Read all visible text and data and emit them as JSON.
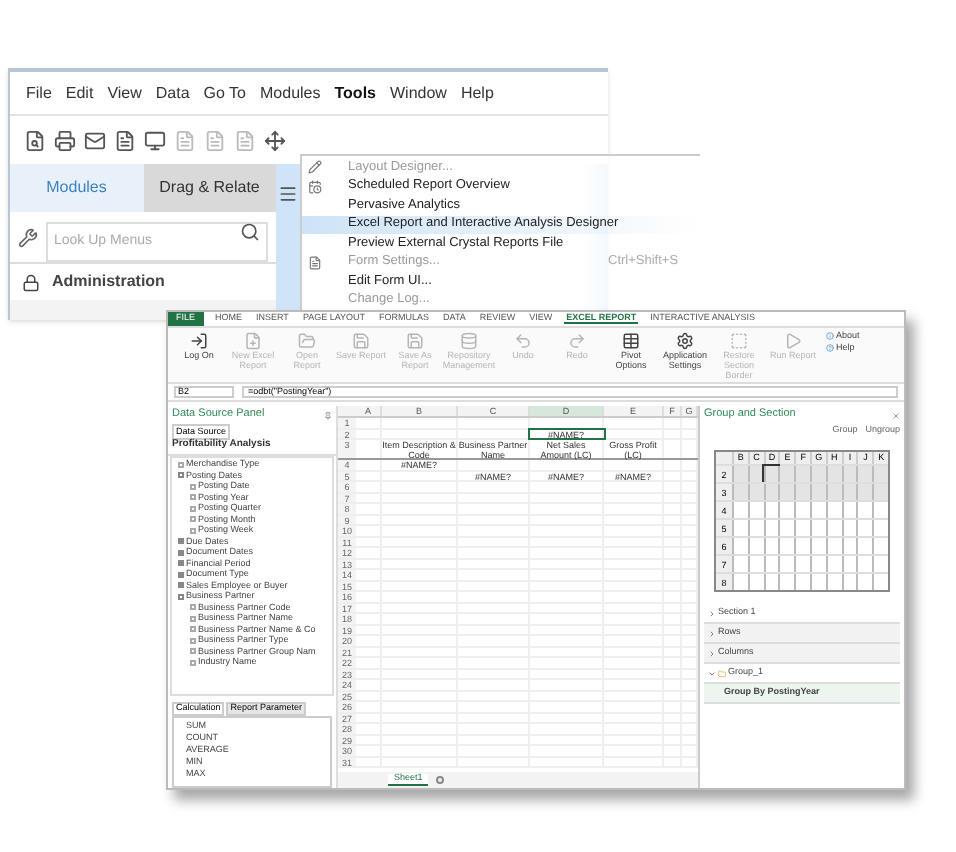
{
  "main_window": {
    "menu": [
      {
        "label": "File",
        "selected": false
      },
      {
        "label": "Edit",
        "selected": false
      },
      {
        "label": "View",
        "selected": false
      },
      {
        "label": "Data",
        "selected": false
      },
      {
        "label": "Go To",
        "selected": false
      },
      {
        "label": "Modules",
        "selected": false
      },
      {
        "label": "Tools",
        "selected": true
      },
      {
        "label": "Window",
        "selected": false
      },
      {
        "label": "Help",
        "selected": false
      }
    ],
    "tabs": [
      {
        "label": "Modules",
        "selected": true
      },
      {
        "label": "Drag & Relate",
        "selected": false
      }
    ],
    "search": {
      "placeholder": "Look Up Menus"
    },
    "module": "Administration"
  },
  "tools_menu": [
    {
      "label": "Layout Designer...",
      "disabled": true,
      "selected": false
    },
    {
      "label": "Scheduled Report Overview",
      "disabled": false,
      "selected": false
    },
    {
      "label": "Pervasive Analytics",
      "disabled": false,
      "selected": false
    },
    {
      "label": "Excel Report and Interactive Analysis Designer",
      "disabled": false,
      "selected": true
    },
    {
      "label": "Preview External Crystal Reports File",
      "disabled": false,
      "selected": false
    },
    {
      "label": "Form Settings...",
      "disabled": true,
      "selected": false,
      "shortcut": "Ctrl+Shift+S"
    },
    {
      "label": "Edit Form UI...",
      "disabled": false,
      "selected": false
    },
    {
      "label": "Change Log...",
      "disabled": true,
      "selected": false
    }
  ],
  "excel_window": {
    "ribbon_tabs": [
      {
        "label": "FILE",
        "kind": "file",
        "selected": false
      },
      {
        "label": "HOME",
        "kind": "tab",
        "selected": false
      },
      {
        "label": "INSERT",
        "kind": "tab",
        "selected": false
      },
      {
        "label": "PAGE LAYOUT",
        "kind": "tab",
        "selected": false
      },
      {
        "label": "FORMULAS",
        "kind": "tab",
        "selected": false
      },
      {
        "label": "DATA",
        "kind": "tab",
        "selected": false
      },
      {
        "label": "REVIEW",
        "kind": "tab",
        "selected": false
      },
      {
        "label": "VIEW",
        "kind": "tab",
        "selected": false
      },
      {
        "label": "EXCEL REPORT",
        "kind": "tab",
        "selected": true
      },
      {
        "label": "INTERACTIVE ANALYSIS",
        "kind": "tab",
        "selected": false
      }
    ],
    "ribbon_buttons": [
      {
        "label": "Log On",
        "kind": "logon",
        "disabled": false
      },
      {
        "label": "New Excel Report",
        "kind": "new",
        "disabled": true
      },
      {
        "label": "Open Report",
        "kind": "open",
        "disabled": true
      },
      {
        "label": "Save Report",
        "kind": "save",
        "disabled": true
      },
      {
        "label": "Save As Report",
        "kind": "save",
        "disabled": true
      },
      {
        "label": "Repository Management",
        "kind": "repository",
        "disabled": true
      },
      {
        "label": "Undo",
        "kind": "undo",
        "disabled": true
      },
      {
        "label": "Redo",
        "kind": "redo",
        "disabled": true
      },
      {
        "label": "Pivot Options",
        "kind": "pivot",
        "disabled": false
      },
      {
        "label": "Application Settings",
        "kind": "settings",
        "disabled": false
      },
      {
        "label": "Restore Section Border",
        "kind": "border",
        "disabled": true
      },
      {
        "label": "Run Report",
        "kind": "run",
        "disabled": true
      }
    ],
    "ribbon_links": [
      "About",
      "Help"
    ],
    "name_box": "B2",
    "formula": "=odbt(\"PostingYear\")",
    "data_source_panel": {
      "title": "Data Source Panel",
      "tab": "Data Source",
      "source": "Profitability Analysis",
      "tree": [
        {
          "label": "Merchandise Type",
          "kind": "field"
        },
        {
          "label": "Posting Dates",
          "kind": "folder",
          "expanded": true,
          "children": [
            {
              "label": "Posting Date",
              "kind": "field"
            },
            {
              "label": "Posting Year",
              "kind": "field"
            },
            {
              "label": "Posting Quarter",
              "kind": "field"
            },
            {
              "label": "Posting Month",
              "kind": "field"
            },
            {
              "label": "Posting Week",
              "kind": "field"
            }
          ]
        },
        {
          "label": "Due Dates",
          "kind": "folder",
          "expanded": false
        },
        {
          "label": "Document Dates",
          "kind": "folder",
          "expanded": false
        },
        {
          "label": "Financial Period",
          "kind": "folder",
          "expanded": false
        },
        {
          "label": "Document Type",
          "kind": "folder",
          "expanded": false
        },
        {
          "label": "Sales Employee or Buyer",
          "kind": "folder",
          "expanded": false
        },
        {
          "label": "Business Partner",
          "kind": "folder",
          "expanded": true,
          "children": [
            {
              "label": "Business Partner Code",
              "kind": "field"
            },
            {
              "label": "Business Partner Name",
              "kind": "field"
            },
            {
              "label": "Business Partner Name & Co",
              "kind": "field"
            },
            {
              "label": "Business Partner Type",
              "kind": "field"
            },
            {
              "label": "Business Partner Group Nam",
              "kind": "field"
            },
            {
              "label": "Industry Name",
              "kind": "field"
            }
          ]
        }
      ],
      "bottom_tabs": [
        {
          "label": "Calculation",
          "selected": true
        },
        {
          "label": "Report Parameter",
          "selected": false
        }
      ],
      "functions": [
        "SUM",
        "COUNT",
        "AVERAGE",
        "MIN",
        "MAX"
      ]
    },
    "sheet": {
      "columns": [
        "A",
        "B",
        "C",
        "D",
        "E",
        "F",
        "G"
      ],
      "rows": [
        {
          "number": "1"
        },
        {
          "number": "2",
          "cells": [
            null,
            null,
            null,
            {
              "text": "#NAME?",
              "selected": true
            },
            null,
            null,
            null
          ]
        },
        {
          "number": "3",
          "cells": [
            null,
            {
              "text": "Item Description & Code",
              "selected": false
            },
            {
              "text": "Business Partner Name",
              "selected": false
            },
            {
              "text": "Net Sales Amount (LC)",
              "selected": false
            },
            {
              "text": "Gross Profit (LC)",
              "selected": false
            },
            null,
            null
          ]
        },
        {
          "number": "4",
          "cells": [
            null,
            {
              "text": "#NAME?",
              "selected": false
            },
            null,
            null,
            null,
            null,
            null
          ]
        },
        {
          "number": "5",
          "cells": [
            null,
            null,
            {
              "text": "#NAME?",
              "selected": false
            },
            {
              "text": "#NAME?",
              "selected": false
            },
            {
              "text": "#NAME?",
              "selected": false
            },
            null,
            null
          ]
        },
        {
          "number": "6"
        },
        {
          "number": "7"
        },
        {
          "number": "8"
        },
        {
          "number": "9"
        },
        {
          "number": "10"
        },
        {
          "number": "11"
        },
        {
          "number": "12"
        },
        {
          "number": "13"
        },
        {
          "number": "14"
        },
        {
          "number": "15"
        },
        {
          "number": "16"
        },
        {
          "number": "17"
        },
        {
          "number": "18"
        },
        {
          "number": "19"
        },
        {
          "number": "20"
        },
        {
          "number": "21"
        },
        {
          "number": "22"
        },
        {
          "number": "23"
        },
        {
          "number": "24"
        },
        {
          "number": "25"
        },
        {
          "number": "26"
        },
        {
          "number": "27"
        },
        {
          "number": "28"
        },
        {
          "number": "29"
        },
        {
          "number": "30"
        },
        {
          "number": "31"
        }
      ],
      "sheet_tab": "Sheet1"
    },
    "group_panel": {
      "title": "Group and Section",
      "buttons": [
        "Group",
        "Ungroup"
      ],
      "grid_columns": [
        "B",
        "C",
        "D",
        "E",
        "F",
        "G",
        "H",
        "I",
        "J",
        "K"
      ],
      "grid_rows": [
        "2",
        "3",
        "4",
        "5",
        "6",
        "7",
        "8"
      ],
      "sections": [
        {
          "label": "Section 1",
          "kind": "section",
          "expanded": false,
          "selected": false
        },
        {
          "label": "Rows",
          "kind": "axis",
          "expanded": false,
          "selected": false
        },
        {
          "label": "Columns",
          "kind": "axis",
          "expanded": false,
          "selected": false
        },
        {
          "label": "Group_1",
          "kind": "group",
          "expanded": true,
          "selected": false
        },
        {
          "label": "Group By PostingYear",
          "kind": "item",
          "selected": true
        }
      ]
    }
  }
}
